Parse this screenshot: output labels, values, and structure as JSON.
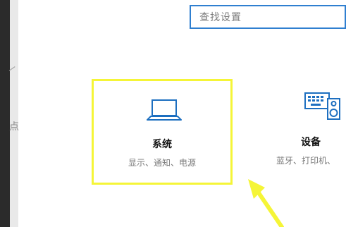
{
  "search": {
    "placeholder": "查找设置"
  },
  "tiles": [
    {
      "title": "系统",
      "subtitle": "显示、通知、电源",
      "icon": "laptop-icon"
    },
    {
      "title": "设备",
      "subtitle": "蓝牙、打印机、",
      "icon": "keyboard-speaker-icon"
    }
  ],
  "colors": {
    "accent": "#2f7fd0",
    "highlight": "#f5f537",
    "icon": "#1d6fc0",
    "arrow": "#f5f537"
  }
}
